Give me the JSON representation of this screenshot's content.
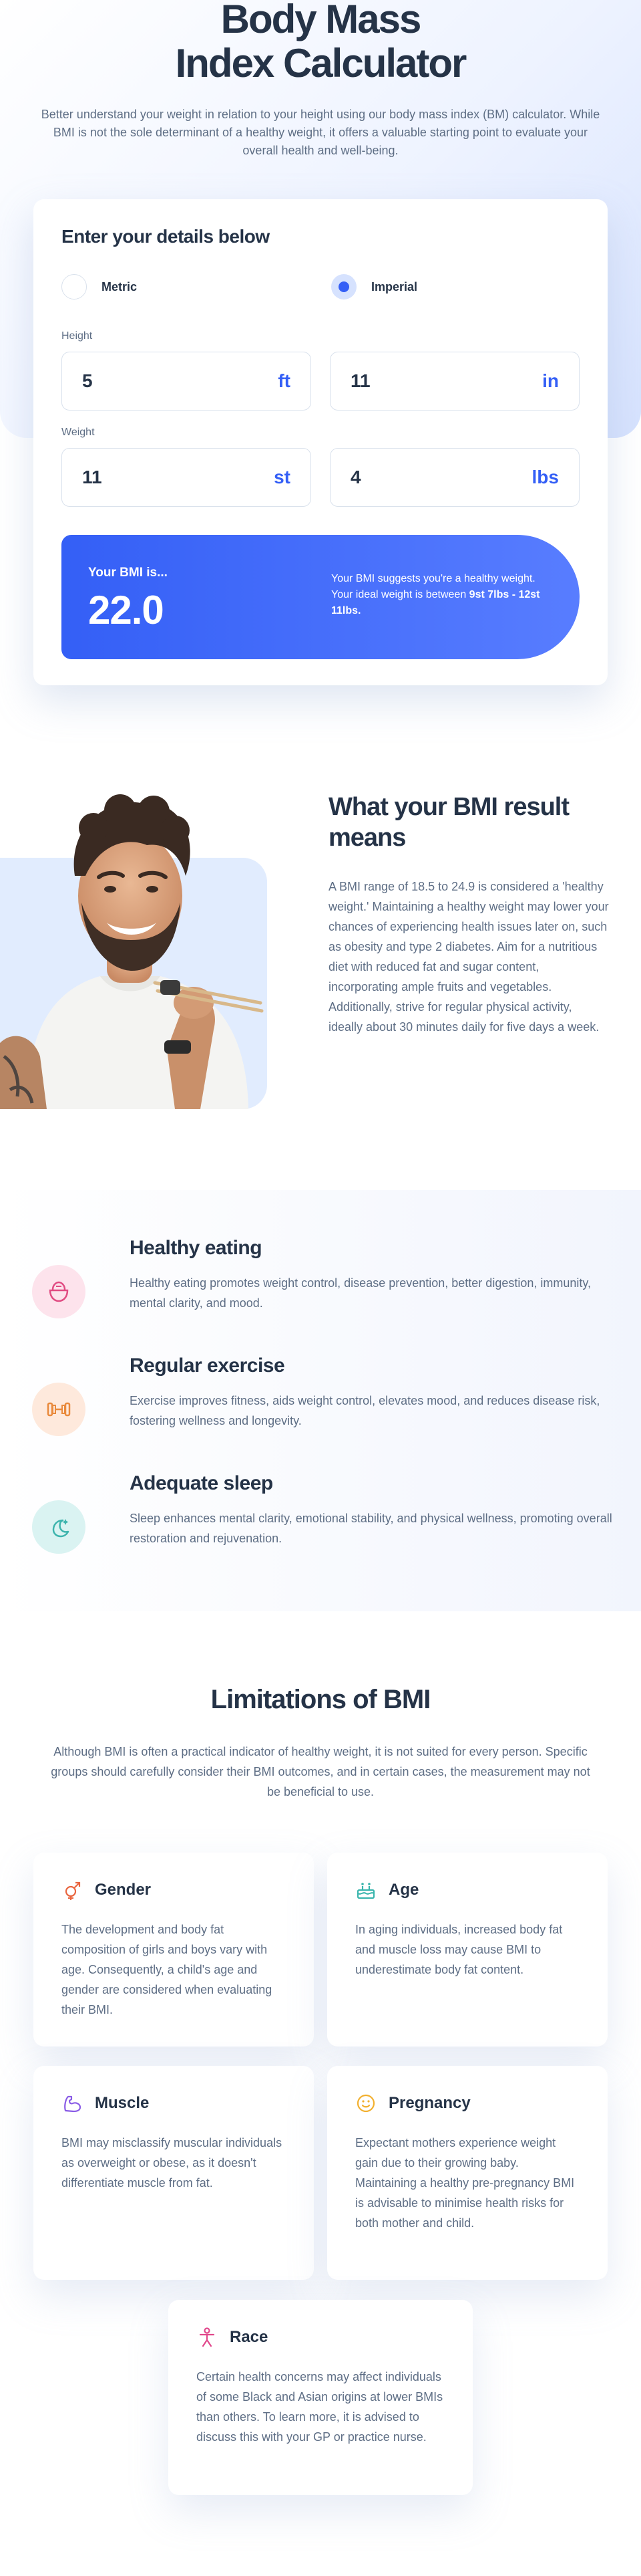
{
  "hero": {
    "title_line1": "Body Mass",
    "title_line2": "Index Calculator",
    "intro": "Better understand your weight in relation to your height using our body mass index (BM) calculator. While BMI is not the sole determinant of a healthy weight, it offers a valuable starting point to evaluate your overall health and well-being."
  },
  "calculator": {
    "heading": "Enter your details below",
    "unit_options": [
      {
        "label": "Metric",
        "selected": false
      },
      {
        "label": "Imperial",
        "selected": true
      }
    ],
    "height_label": "Height",
    "height_ft": {
      "value": "5",
      "unit": "ft"
    },
    "height_in": {
      "value": "11",
      "unit": "in"
    },
    "weight_label": "Weight",
    "weight_st": {
      "value": "11",
      "unit": "st"
    },
    "weight_lbs": {
      "value": "4",
      "unit": "lbs"
    },
    "result": {
      "caption": "Your BMI is...",
      "value": "22.0",
      "summary": "Your BMI suggests you're a healthy weight. Your ideal weight is between",
      "range": "9st 7lbs - 12st 11lbs."
    }
  },
  "meaning": {
    "title": "What your BMI result means",
    "body": "A BMI range of 18.5 to 24.9 is considered a 'healthy weight.' Maintaining a healthy weight may lower your chances of experiencing health issues later on, such as obesity and type 2 diabetes. Aim for a nutritious diet with reduced fat and sugar content, incorporating ample fruits and vegetables. Additionally, strive for regular physical activity, ideally about 30 minutes daily for five days a week."
  },
  "tips": [
    {
      "title": "Healthy eating",
      "body": "Healthy eating promotes weight control, disease prevention, better digestion, immunity, mental clarity, and mood.",
      "icon": "bowl-icon",
      "icon_bg": "#fde3ec",
      "icon_color": "#e14c83"
    },
    {
      "title": "Regular exercise",
      "body": "Exercise improves fitness, aids weight control, elevates mood, and reduces disease risk, fostering wellness and longevity.",
      "icon": "dumbbell-icon",
      "icon_bg": "#fee9dc",
      "icon_color": "#e98a3c"
    },
    {
      "title": "Adequate sleep",
      "body": "Sleep enhances mental clarity, emotional stability, and physical wellness, promoting overall restoration and rejuvenation.",
      "icon": "moon-icon",
      "icon_bg": "#daf3f2",
      "icon_color": "#3db4ad"
    }
  ],
  "limitations": {
    "title": "Limitations of BMI",
    "intro": "Although BMI is often a practical indicator of healthy weight, it is not suited for every person. Specific groups should carefully consider their BMI outcomes, and in certain cases, the measurement may not be beneficial to use.",
    "items": [
      {
        "title": "Gender",
        "body": "The development and body fat composition of girls and boys vary with age. Consequently, a child's age and gender are considered when evaluating their BMI.",
        "icon": "gender-icon"
      },
      {
        "title": "Age",
        "body": "In aging individuals, increased body fat and muscle loss may cause BMI to underestimate body fat content.",
        "icon": "cake-icon"
      },
      {
        "title": "Muscle",
        "body": "BMI may misclassify muscular individuals as overweight or obese, as it doesn't differentiate muscle from fat.",
        "icon": "bicep-icon"
      },
      {
        "title": "Pregnancy",
        "body": "Expectant mothers experience weight gain due to their growing baby. Maintaining a healthy pre-pregnancy BMI is advisable to minimise health risks for both mother and child.",
        "icon": "smile-icon"
      },
      {
        "title": "Race",
        "body": "Certain health concerns may affect individuals of some Black and Asian origins at lower BMIs than others. To learn more, it is advised to discuss this with your GP or practice nurse.",
        "icon": "person-icon"
      }
    ]
  },
  "colors": {
    "accent": "#345ff6",
    "heading": "#253347",
    "body": "#5e6e85"
  }
}
